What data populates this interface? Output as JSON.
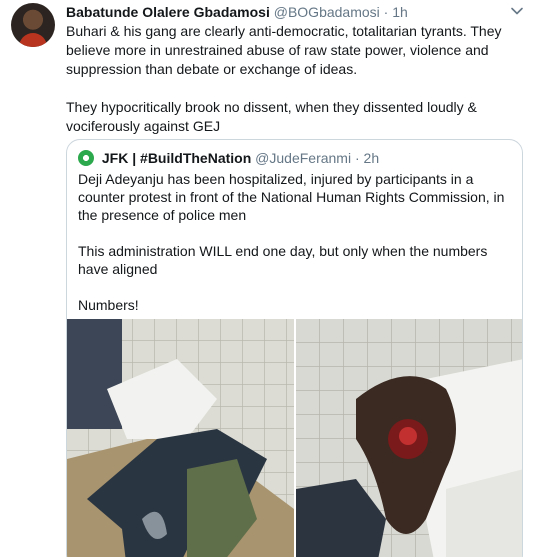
{
  "tweet": {
    "author_name": "Babatunde Olalere Gbadamosi",
    "handle": "@BOGbadamosi",
    "separator": "·",
    "time": "1h",
    "avatar_icon": "profile-avatar",
    "menu_icon": "chevron-down-icon",
    "paragraph1": "Buhari & his gang are clearly anti-democratic, totalitarian tyrants. They believe more in unrestrained abuse of raw state power, violence and suppression than debate or exchange of ideas.",
    "paragraph2": "They hypocritically brook no dissent, when they dissented loudly & vociferously against GEJ"
  },
  "quoted": {
    "author_name": "JFK | #BuildTheNation",
    "handle": "@JudeFeranmi",
    "separator": "·",
    "time": "2h",
    "line1": "Deji Adeyanju has been hospitalized, injured by participants in a counter protest in front of the National Human Rights Commission, in the presence of police men",
    "line2": "This administration WILL end one day, but only when the numbers have aligned",
    "line3": "Numbers!",
    "accent_color": "#2ca84d"
  },
  "colors": {
    "text": "#14171a",
    "secondary": "#657786",
    "border": "#ccd6dd"
  }
}
